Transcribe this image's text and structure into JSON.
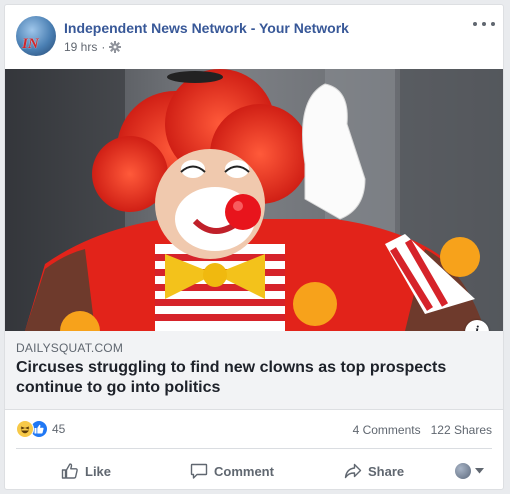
{
  "post": {
    "page_name": "Independent News Network - Your Network",
    "avatar_text": "IN",
    "time": "19 hrs",
    "separator": "·"
  },
  "link_preview": {
    "domain": "DAILYSQUAT.COM",
    "headline": "Circuses struggling to find new clowns as top prospects continue to go into politics",
    "info_label": "i"
  },
  "stats": {
    "reaction_count": "45",
    "comments": "4 Comments",
    "shares": "122 Shares"
  },
  "actions": {
    "like": "Like",
    "comment": "Comment",
    "share": "Share"
  },
  "icons": {
    "settings": "gear-icon",
    "more": "more-options-icon",
    "like": "thumbs-up-icon",
    "comment": "comment-bubble-icon",
    "share": "share-arrow-icon",
    "audience": "globe-icon",
    "dropdown": "caret-down-icon"
  },
  "colors": {
    "link": "#385898",
    "reaction_like": "#2078f4",
    "reaction_haha": "#f7c948",
    "muted": "#606770"
  }
}
